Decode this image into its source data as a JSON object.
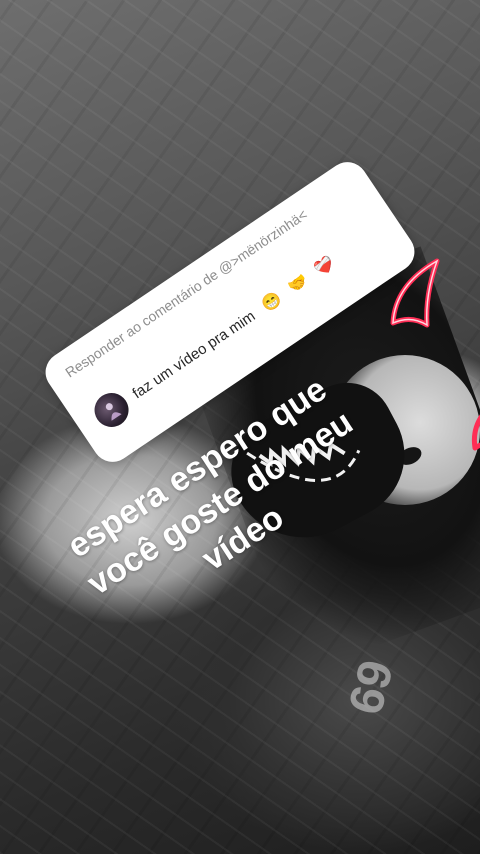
{
  "reply_sticker": {
    "header": "Responder ao comentário de @>mënörzinhä<",
    "comment": "faz um vídeo pra mim",
    "emojis": [
      "😁",
      "🤝",
      "❤️‍🩹"
    ]
  },
  "caption": {
    "lines": [
      "espera espero que",
      "você goste do meu",
      "vídeo"
    ]
  },
  "background": {
    "shirt_number": "69"
  },
  "colors": {
    "horn_outline": "#ff2d55",
    "sticker_bg": "#ffffff",
    "sticker_header": "#8e8e8e",
    "comment_text": "#262626",
    "caption_text": "#ffffff"
  }
}
